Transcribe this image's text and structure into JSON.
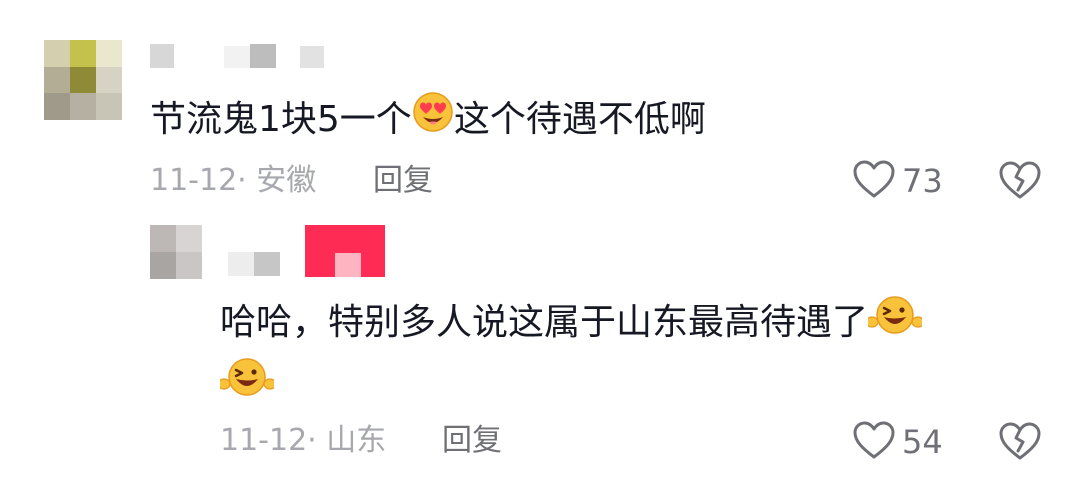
{
  "comments": [
    {
      "text_before_emoji": "节流鬼1块5一个",
      "emoji": "heart-eyes-emoji",
      "text_after_emoji": "这个待遇不低啊",
      "meta": "11-12· 安徽",
      "reply_label": "回复",
      "like_count": "73"
    },
    {
      "text": "哈哈，特别多人说这属于山东最高待遇了",
      "emoji": "grinning-squint-emoji",
      "trailing_emoji": "grinning-squint-emoji",
      "meta": "11-12· 山东",
      "reply_label": "回复",
      "like_count": "54"
    }
  ],
  "colors": {
    "text": "#161823",
    "meta": "#a7a8ad",
    "reply": "#6f7076",
    "author_badge": "#fe2c55"
  }
}
